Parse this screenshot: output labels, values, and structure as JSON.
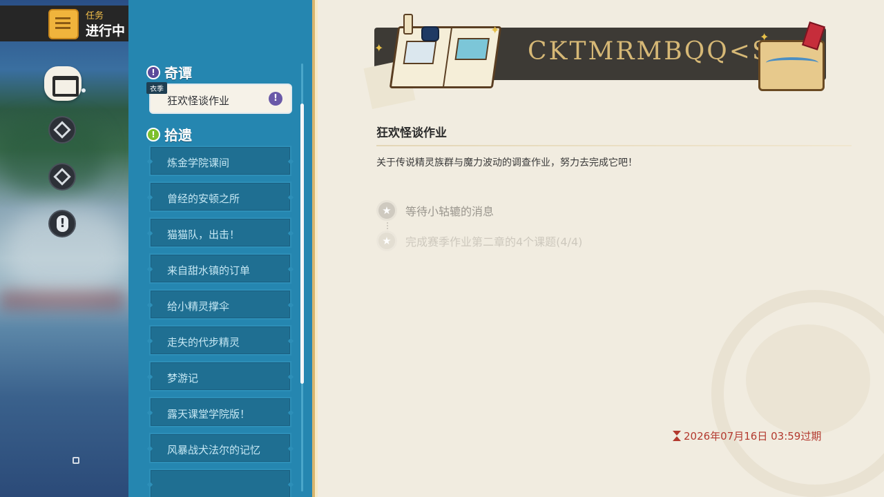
{
  "header": {
    "small_label": "任务",
    "big_label": "进行中",
    "icon": "quest-scroll-icon"
  },
  "nav": {
    "items": [
      {
        "name": "quest-book-icon",
        "selected": true
      },
      {
        "name": "compass-quest-icon",
        "selected": false
      },
      {
        "name": "compass-quest-icon-alt",
        "selected": false
      },
      {
        "name": "alert-quest-icon",
        "selected": false
      }
    ]
  },
  "sections": [
    {
      "title": "奇谭",
      "badge_icon": "exclamation-icon",
      "badge_color": "#5b4a9a"
    },
    {
      "title": "拾遗",
      "badge_icon": "exclamation-icon",
      "badge_color": "#7cbf2c"
    }
  ],
  "active_quest": {
    "tag": "衣季",
    "label": "狂欢怪谈作业",
    "alert_icon": "exclamation-icon"
  },
  "quest_list": [
    "炼金学院课间",
    "曾经的安顿之所",
    "猫猫队，出击！",
    "来自甜水镇的订单",
    "给小精灵撑伞",
    "走失的代步精灵",
    "梦游记",
    "露天课堂学院版！",
    "风暴战犬法尔的记忆"
  ],
  "detail": {
    "banner_text": "CKTMRMBQQ<S",
    "title": "狂欢怪谈作业",
    "description": "关于传说精灵族群与魔力波动的调查作业，努力去完成它吧！",
    "steps": [
      {
        "text": "等待小轱辘的消息",
        "state": "current"
      },
      {
        "text": "完成赛季作业第二章的4个课题(4/4)",
        "state": "completed"
      }
    ],
    "expiry": "2026年07月16日 03:59过期"
  },
  "colors": {
    "panel": "#2586b0",
    "content_bg": "#f1ece0",
    "accent_gold": "#f0b43c",
    "expiry_red": "#b3392e"
  }
}
